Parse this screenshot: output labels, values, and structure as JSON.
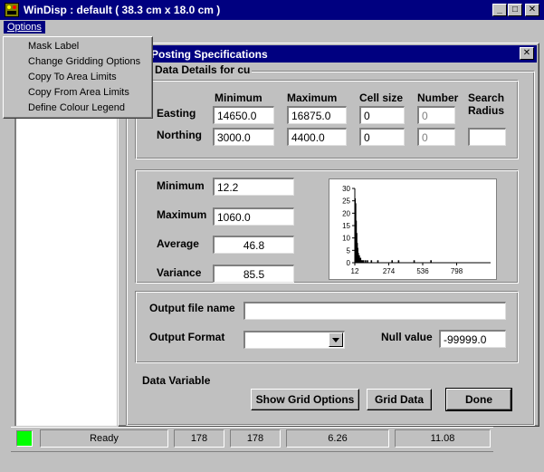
{
  "window": {
    "title": "WinDisp : default ( 38.3 cm x 18.0 cm )"
  },
  "menubar": {
    "options": "Options"
  },
  "menu": {
    "items": [
      {
        "label": "Mask Label"
      },
      {
        "label": "Change Gridding Options"
      },
      {
        "label": "Copy To Area Limits"
      },
      {
        "label": "Copy From Area Limits"
      },
      {
        "label": "Define Colour Legend"
      }
    ]
  },
  "dialog": {
    "title": "Posting Specifications",
    "group_title": "Data Details for cu",
    "columns": {
      "minimum": "Minimum",
      "maximum": "Maximum",
      "cell_size": "Cell size",
      "number": "Number",
      "search_radius": "Search Radius"
    },
    "easting": {
      "label": "Easting",
      "min": "14650.0",
      "max": "16875.0",
      "cell": "0",
      "number": "0",
      "radius": ""
    },
    "northing": {
      "label": "Northing",
      "min": "3000.0",
      "max": "4400.0",
      "cell": "0",
      "number": "0",
      "radius": ""
    },
    "stats": {
      "minimum_label": "Minimum",
      "minimum": "12.2",
      "maximum_label": "Maximum",
      "maximum": "1060.0",
      "average_label": "Average",
      "average": "46.8",
      "variance_label": "Variance",
      "variance": "85.5"
    },
    "output": {
      "file_label": "Output file name",
      "file_value": "",
      "format_label": "Output Format",
      "format_value": "",
      "null_label": "Null value",
      "null_value": "-99999.0"
    },
    "data_variable_label": "Data Variable",
    "buttons": {
      "show_grid": "Show Grid Options",
      "grid_data": "Grid Data",
      "done": "Done"
    }
  },
  "chart_data": {
    "type": "bar",
    "title": "",
    "xlabel": "",
    "ylabel": "",
    "xlim": [
      12,
      1060
    ],
    "ylim": [
      0,
      30
    ],
    "x_ticks": [
      "12",
      "274",
      "536",
      "798"
    ],
    "y_ticks": [
      "0",
      "5",
      "10",
      "15",
      "20",
      "25",
      "30"
    ],
    "x": [
      14,
      18,
      22,
      26,
      30,
      34,
      38,
      42,
      46,
      50,
      56,
      62,
      70,
      80,
      95,
      110,
      140,
      190,
      300,
      350,
      470,
      600
    ],
    "values": [
      26,
      24,
      17,
      12,
      8,
      6,
      4,
      3,
      3,
      2,
      2,
      1,
      1,
      1,
      1,
      1,
      1,
      1,
      1,
      1,
      1,
      1
    ]
  },
  "statusbar": {
    "indicator_color": "#00ff00",
    "status": "Ready",
    "c1": "178",
    "c2": "178",
    "c3": "6.26",
    "c4": "11.08"
  }
}
